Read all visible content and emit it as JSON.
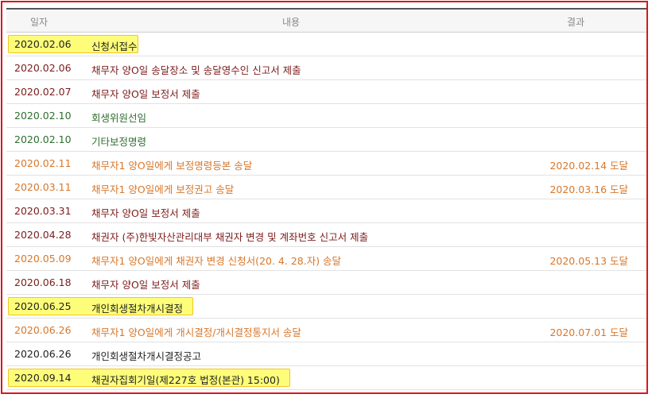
{
  "table": {
    "headers": {
      "date": "일자",
      "content": "내용",
      "result": "결과"
    },
    "rows": [
      {
        "date": "2020.02.06",
        "content": "신청서접수",
        "result": "",
        "color": "black",
        "highlight": true
      },
      {
        "date": "2020.02.06",
        "content": "채무자 양O일 송달장소 및 송달영수인 신고서 제출",
        "result": "",
        "color": "maroon",
        "highlight": false
      },
      {
        "date": "2020.02.07",
        "content": "채무자 양O일 보정서 제출",
        "result": "",
        "color": "maroon",
        "highlight": false
      },
      {
        "date": "2020.02.10",
        "content": "회생위원선임",
        "result": "",
        "color": "green",
        "highlight": false
      },
      {
        "date": "2020.02.10",
        "content": "기타보정명령",
        "result": "",
        "color": "green",
        "highlight": false
      },
      {
        "date": "2020.02.11",
        "content": "채무자1 양O일에게 보정명령등본 송달",
        "result": "2020.02.14 도달",
        "color": "orange",
        "highlight": false
      },
      {
        "date": "2020.03.11",
        "content": "채무자1 양O일에게 보정권고 송달",
        "result": "2020.03.16 도달",
        "color": "orange",
        "highlight": false
      },
      {
        "date": "2020.03.31",
        "content": "채무자 양O일 보정서 제출",
        "result": "",
        "color": "maroon",
        "highlight": false
      },
      {
        "date": "2020.04.28",
        "content": "채권자 (주)한빛자산관리대부 채권자 변경 및 계좌번호 신고서 제출",
        "result": "",
        "color": "maroon",
        "highlight": false
      },
      {
        "date": "2020.05.09",
        "content": "채무자1 양O일에게 채권자 변경 신청서(20. 4. 28.자) 송달",
        "result": "2020.05.13 도달",
        "color": "orange",
        "highlight": false
      },
      {
        "date": "2020.06.18",
        "content": "채무자 양O일 보정서 제출",
        "result": "",
        "color": "maroon",
        "highlight": false
      },
      {
        "date": "2020.06.25",
        "content": "개인회생절차개시결정",
        "result": "",
        "color": "black",
        "highlight": true
      },
      {
        "date": "2020.06.26",
        "content": "채무자1 양O일에게 개시결정/개시결정통지서 송달",
        "result": "2020.07.01 도달",
        "color": "orange",
        "highlight": false
      },
      {
        "date": "2020.06.26",
        "content": "개인회생절차개시결정공고",
        "result": "",
        "color": "black",
        "highlight": false
      },
      {
        "date": "2020.09.14",
        "content": "채권자집회기일(제227호 법정(본관) 15:00)",
        "result": "",
        "color": "black",
        "highlight": true
      }
    ]
  },
  "colors": {
    "frame_border": "#d6191f",
    "highlight_fill": "#fdfd7a",
    "highlight_border": "#f2c624",
    "black": "#222222",
    "maroon": "#7d1b1b",
    "green": "#2e6e2e",
    "orange": "#d8772a"
  }
}
